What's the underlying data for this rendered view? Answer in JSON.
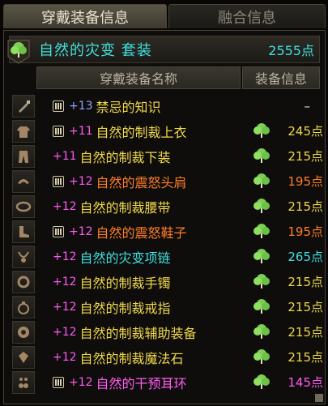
{
  "tabs": [
    {
      "label": "穿戴装备信息",
      "active": true
    },
    {
      "label": "融合信息",
      "active": false
    }
  ],
  "set": {
    "name": "自然的灾变 套装",
    "points": "2555点",
    "color": "#3fe0e0"
  },
  "header": {
    "name_col": "穿戴装备名称",
    "info_col": "装备信息"
  },
  "items": [
    {
      "slot": "weapon",
      "lock": true,
      "enh": "+13",
      "enh_color": "#8ea4ff",
      "name": "禁忌的知识",
      "name_color": "#f0d84a",
      "icon": false,
      "points": "–",
      "points_color": "#e8e3d2"
    },
    {
      "slot": "top",
      "lock": true,
      "enh": "+11",
      "enh_color": "#ff5af0",
      "name": "自然的制裁上衣",
      "name_color": "#f0d84a",
      "icon": true,
      "points": "245点",
      "points_color": "#f0d84a"
    },
    {
      "slot": "pants",
      "lock": false,
      "enh": "+11",
      "enh_color": "#ff5af0",
      "name": "自然的制裁下装",
      "name_color": "#f0d84a",
      "icon": true,
      "points": "215点",
      "points_color": "#f0d84a"
    },
    {
      "slot": "shoulder",
      "lock": true,
      "enh": "+12",
      "enh_color": "#ff5af0",
      "name": "自然的震怒头肩",
      "name_color": "#ff7d2a",
      "icon": true,
      "points": "195点",
      "points_color": "#ff7d2a"
    },
    {
      "slot": "belt",
      "lock": false,
      "enh": "+12",
      "enh_color": "#ff5af0",
      "name": "自然的制裁腰带",
      "name_color": "#f0d84a",
      "icon": true,
      "points": "215点",
      "points_color": "#f0d84a"
    },
    {
      "slot": "shoes",
      "lock": true,
      "enh": "+12",
      "enh_color": "#ff5af0",
      "name": "自然的震怒鞋子",
      "name_color": "#ff7d2a",
      "icon": true,
      "points": "195点",
      "points_color": "#ff7d2a"
    },
    {
      "slot": "necklace",
      "lock": false,
      "enh": "+12",
      "enh_color": "#ff5af0",
      "name": "自然的灾变项链",
      "name_color": "#3fe0e0",
      "icon": true,
      "points": "265点",
      "points_color": "#3fe0e0"
    },
    {
      "slot": "bracelet",
      "lock": false,
      "enh": "+12",
      "enh_color": "#ff5af0",
      "name": "自然的制裁手镯",
      "name_color": "#f0d84a",
      "icon": true,
      "points": "215点",
      "points_color": "#f0d84a"
    },
    {
      "slot": "ring",
      "lock": false,
      "enh": "+12",
      "enh_color": "#ff5af0",
      "name": "自然的制裁戒指",
      "name_color": "#f0d84a",
      "icon": true,
      "points": "215点",
      "points_color": "#f0d84a"
    },
    {
      "slot": "support",
      "lock": false,
      "enh": "+12",
      "enh_color": "#ff5af0",
      "name": "自然的制裁辅助装备",
      "name_color": "#f0d84a",
      "icon": true,
      "points": "215点",
      "points_color": "#f0d84a"
    },
    {
      "slot": "magicstone",
      "lock": false,
      "enh": "+12",
      "enh_color": "#ff5af0",
      "name": "自然的制裁魔法石",
      "name_color": "#f0d84a",
      "icon": true,
      "points": "215点",
      "points_color": "#f0d84a"
    },
    {
      "slot": "earring",
      "lock": true,
      "enh": "+12",
      "enh_color": "#ff5af0",
      "name": "自然的干预耳环",
      "name_color": "#ff5af0",
      "icon": true,
      "points": "145点",
      "points_color": "#ff5af0"
    }
  ]
}
